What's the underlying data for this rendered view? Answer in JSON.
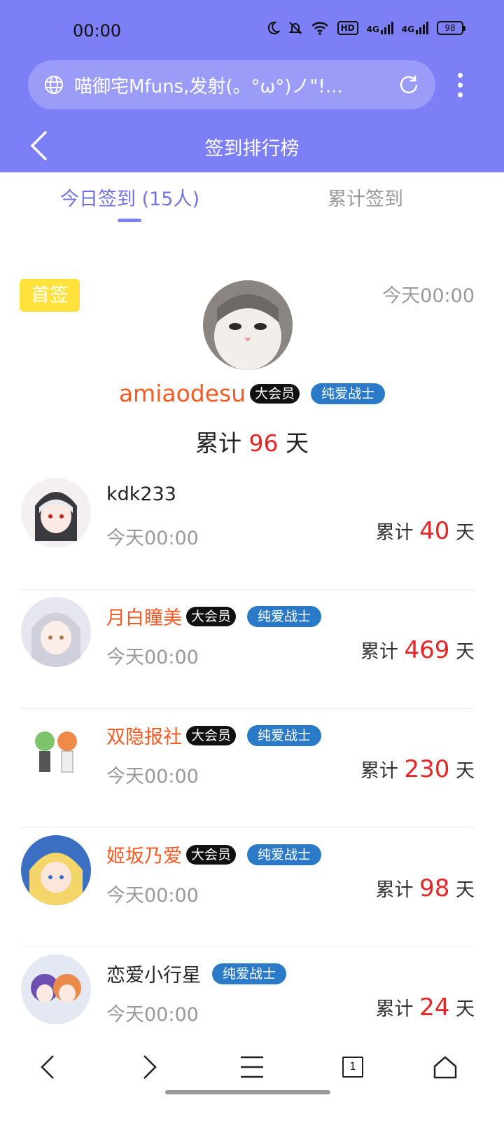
{
  "status_bar": {
    "time": "00:00",
    "hd_label": "HD",
    "net1": "4G",
    "net2": "4G",
    "battery": "98"
  },
  "browser": {
    "url_title": "喵御宅Mfuns,发射(。°ω°)ノ\"!..."
  },
  "header": {
    "title": "签到排行榜"
  },
  "tabs": [
    {
      "label": "今日签到 (15人)",
      "active": true
    },
    {
      "label": "累计签到",
      "active": false
    }
  ],
  "first_sign": {
    "badge": "首签",
    "time": "今天00:00",
    "username": "amiaodesu",
    "tags": [
      "大会员",
      "纯爱战士"
    ],
    "total_prefix": "累计",
    "total_days": "96",
    "total_suffix": "天"
  },
  "list": [
    {
      "name": "kdk233",
      "orange": false,
      "tags": [],
      "time": "今天00:00",
      "total_prefix": "累计",
      "days": "40",
      "suffix": "天"
    },
    {
      "name": "月白瞳美",
      "orange": true,
      "tags": [
        "大会员",
        "纯爱战士"
      ],
      "time": "今天00:00",
      "total_prefix": "累计",
      "days": "469",
      "suffix": "天"
    },
    {
      "name": "双隐报社",
      "orange": true,
      "tags": [
        "大会员",
        "纯爱战士"
      ],
      "time": "今天00:00",
      "total_prefix": "累计",
      "days": "230",
      "suffix": "天"
    },
    {
      "name": "姬坂乃爱",
      "orange": true,
      "tags": [
        "大会员",
        "纯爱战士"
      ],
      "time": "今天00:00",
      "total_prefix": "累计",
      "days": "98",
      "suffix": "天"
    },
    {
      "name": "恋爱小行星",
      "orange": false,
      "tags": [
        "纯爱战士"
      ],
      "time": "今天00:00",
      "total_prefix": "累计",
      "days": "24",
      "suffix": "天"
    }
  ],
  "bottom_nav": {
    "tab_count": "1"
  },
  "colors": {
    "header_bg": "#7c7ff5",
    "accent_orange": "#f35a24",
    "count_red": "#e32626",
    "tag_blue": "#2b7ac8"
  }
}
